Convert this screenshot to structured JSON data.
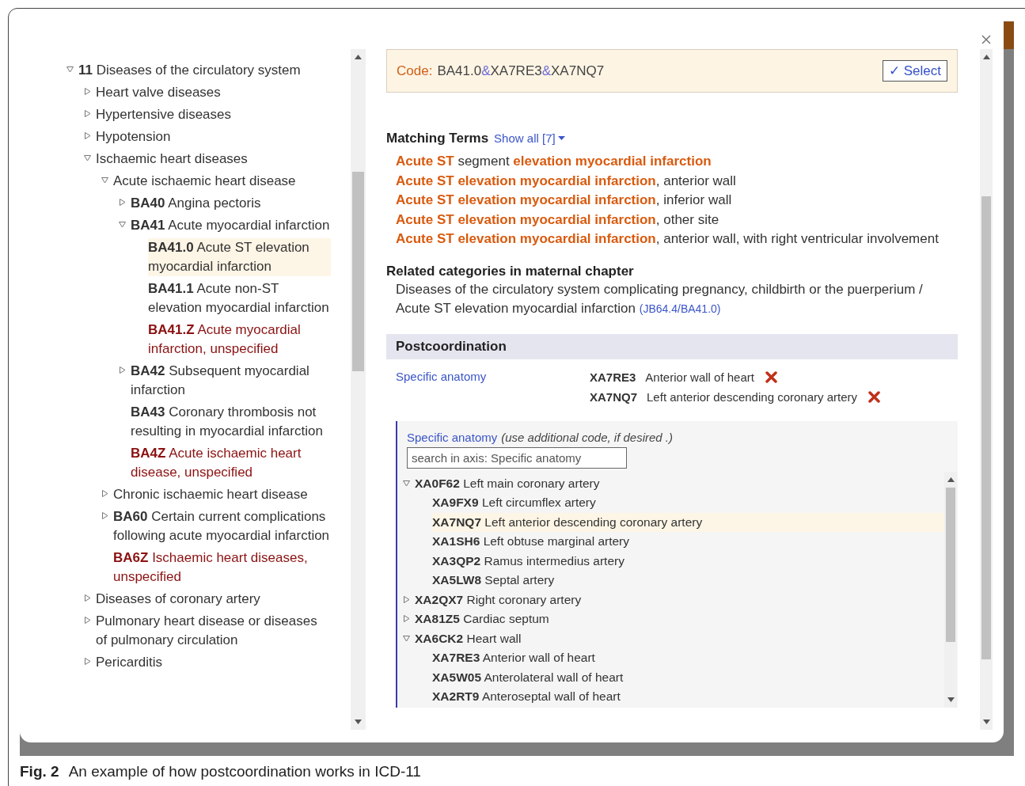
{
  "left_tree": {
    "items": [
      {
        "code": "11",
        "title": "Diseases of the circulatory system",
        "expanded": true,
        "selected": false,
        "residual": false,
        "children": [
          {
            "title": "Heart valve diseases",
            "expanded": false,
            "selected": false,
            "residual": false
          },
          {
            "title": "Hypertensive diseases",
            "expanded": false,
            "selected": false,
            "residual": false
          },
          {
            "title": "Hypotension",
            "expanded": false,
            "selected": false,
            "residual": false
          },
          {
            "title": "Ischaemic heart diseases",
            "expanded": true,
            "selected": false,
            "residual": false,
            "children": [
              {
                "title": "Acute ischaemic heart disease",
                "expanded": true,
                "selected": false,
                "residual": false,
                "children": [
                  {
                    "code": "BA40",
                    "title": "Angina pectoris",
                    "expanded": false,
                    "selected": false,
                    "residual": false
                  },
                  {
                    "code": "BA41",
                    "title": "Acute myocardial infarction",
                    "expanded": true,
                    "selected": false,
                    "residual": false,
                    "children": [
                      {
                        "code": "BA41.0",
                        "title": "Acute ST elevation myocardial infarction",
                        "selected": true,
                        "residual": false
                      },
                      {
                        "code": "BA41.1",
                        "title": "Acute non-ST elevation myocardial infarction",
                        "selected": false,
                        "residual": false
                      },
                      {
                        "code": "BA41.Z",
                        "title": "Acute myocardial infarction, unspecified",
                        "selected": false,
                        "residual": true
                      }
                    ]
                  },
                  {
                    "code": "BA42",
                    "title": "Subsequent myocardial infarction",
                    "expanded": false,
                    "selected": false,
                    "residual": false
                  },
                  {
                    "code": "BA43",
                    "title": "Coronary thrombosis not resulting in myocardial infarction",
                    "selected": false,
                    "residual": false
                  },
                  {
                    "code": "BA4Z",
                    "title": "Acute ischaemic heart disease, unspecified",
                    "selected": false,
                    "residual": true
                  }
                ]
              },
              {
                "title": "Chronic ischaemic heart disease",
                "expanded": false,
                "selected": false,
                "residual": false
              },
              {
                "code": "BA60",
                "title": "Certain current complications following acute myocardial infarction",
                "expanded": false,
                "selected": false,
                "residual": false
              },
              {
                "code": "BA6Z",
                "title": "Ischaemic heart diseases, unspecified",
                "selected": false,
                "residual": true
              }
            ]
          },
          {
            "title": "Diseases of coronary artery",
            "expanded": false,
            "selected": false,
            "residual": false
          },
          {
            "title": "Pulmonary heart disease or diseases of pulmonary circulation",
            "expanded": false,
            "selected": false,
            "residual": false
          },
          {
            "title": "Pericarditis",
            "expanded": false,
            "selected": false,
            "residual": false
          }
        ]
      }
    ]
  },
  "code_box": {
    "label": "Code:",
    "parts": [
      {
        "text": "BA41.0",
        "kind": "code"
      },
      {
        "text": "&",
        "kind": "separator"
      },
      {
        "text": "XA7RE3",
        "kind": "code"
      },
      {
        "text": "&",
        "kind": "separator"
      },
      {
        "text": "XA7NQ7",
        "kind": "code"
      }
    ],
    "select_button": "✓ Select"
  },
  "matching_terms": {
    "heading": "Matching Terms",
    "show_all": "Show all [7]",
    "terms": [
      "**Acute ST** segment **elevation myocardial infarction**",
      "**Acute ST elevation myocardial infarction**, anterior wall",
      "**Acute ST elevation myocardial infarction**, inferior wall",
      "**Acute ST elevation myocardial infarction**, other site",
      "**Acute ST elevation myocardial infarction**, anterior wall, with right ventricular involvement"
    ]
  },
  "related": {
    "heading": "Related categories in maternal chapter",
    "text": "Diseases of the circulatory system complicating pregnancy, childbirth or the puerperium / Acute ST elevation myocardial infarction",
    "link": "(JB64.4/BA41.0)"
  },
  "postcoordination": {
    "heading": "Postcoordination",
    "axes": [
      {
        "label": "Specific anatomy",
        "values": [
          {
            "code": "XA7RE3",
            "name": "Anterior wall of heart"
          },
          {
            "code": "XA7NQ7",
            "name": "Left anterior descending coronary artery"
          }
        ]
      }
    ],
    "picker": {
      "label": "Specific anatomy",
      "hint": "(use additional code, if desired .)",
      "placeholder": "search in axis: Specific anatomy",
      "items": [
        {
          "code": "XA0F62",
          "title": "Left main coronary artery",
          "expanded": true,
          "selected": false,
          "children": [
            {
              "code": "XA9FX9",
              "title": "Left circumflex artery",
              "selected": false
            },
            {
              "code": "XA7NQ7",
              "title": "Left anterior descending coronary artery",
              "selected": true
            },
            {
              "code": "XA1SH6",
              "title": "Left obtuse marginal artery",
              "selected": false
            },
            {
              "code": "XA3QP2",
              "title": "Ramus intermedius artery",
              "selected": false
            },
            {
              "code": "XA5LW8",
              "title": "Septal artery",
              "selected": false
            }
          ]
        },
        {
          "code": "XA2QX7",
          "title": "Right coronary artery",
          "expanded": false,
          "selected": false
        },
        {
          "code": "XA81Z5",
          "title": "Cardiac septum",
          "expanded": false,
          "selected": false
        },
        {
          "code": "XA6CK2",
          "title": "Heart wall",
          "expanded": true,
          "selected": false,
          "children": [
            {
              "code": "XA7RE3",
              "title": "Anterior wall of heart",
              "selected": false
            },
            {
              "code": "XA5W05",
              "title": "Anterolateral wall of heart",
              "selected": false
            },
            {
              "code": "XA2RT9",
              "title": "Anteroseptal wall of heart",
              "selected": false
            }
          ]
        }
      ]
    }
  },
  "caption": {
    "label": "Fig. 2",
    "text": "An example of how postcoordination works in ICD-11"
  }
}
